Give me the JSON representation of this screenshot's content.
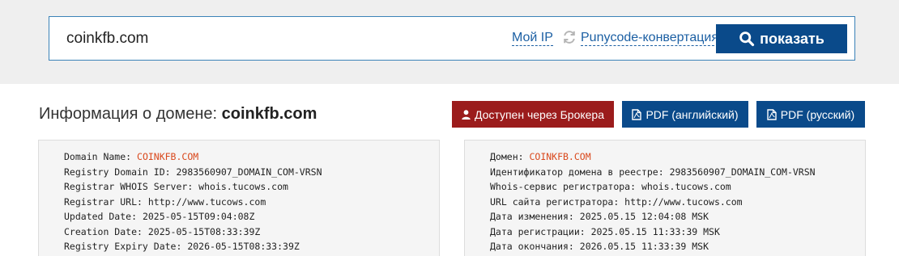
{
  "search": {
    "value": "coinkfb.com",
    "my_ip": "Мой IP",
    "punycode": "Punycode-конвертация",
    "show_button": "показать"
  },
  "header": {
    "title_prefix": "Информация о домене: ",
    "domain": "coinkfb.com",
    "broker_button": "Доступен через Брокера",
    "pdf_en": "PDF (английский)",
    "pdf_ru": "PDF (русский)"
  },
  "colors": {
    "accent_blue": "#0a4a8a",
    "broker_red": "#9b1c1c",
    "highlight_orange": "#d9481c"
  },
  "whois_en": [
    {
      "label": "Domain Name: ",
      "value": "COINKFB.COM"
    },
    {
      "label": "Registry Domain ID: ",
      "value": "2983560907_DOMAIN_COM-VRSN"
    },
    {
      "label": "Registrar WHOIS Server: ",
      "value": "whois.tucows.com"
    },
    {
      "label": "Registrar URL: ",
      "value": "http://www.tucows.com"
    },
    {
      "label": "Updated Date: ",
      "value": "2025-05-15T09:04:08Z"
    },
    {
      "label": "Creation Date: ",
      "value": "2025-05-15T08:33:39Z"
    },
    {
      "label": "Registry Expiry Date: ",
      "value": "2026-05-15T08:33:39Z"
    }
  ],
  "whois_ru": [
    {
      "label": "Домен: ",
      "value": "COINKFB.COM"
    },
    {
      "label": "Идентификатор домена в реестре: ",
      "value": "2983560907_DOMAIN_COM-VRSN"
    },
    {
      "label": "Whois-сервис регистратора: ",
      "value": "whois.tucows.com"
    },
    {
      "label": "URL сайта регистратора: ",
      "value": "http://www.tucows.com"
    },
    {
      "label": "Дата изменения: ",
      "value": "2025.05.15 12:04:08 MSK"
    },
    {
      "label": "Дата регистрации: ",
      "value": "2025.05.15 11:33:39 MSK"
    },
    {
      "label": "Дата окончания: ",
      "value": "2026.05.15 11:33:39 MSK"
    }
  ]
}
